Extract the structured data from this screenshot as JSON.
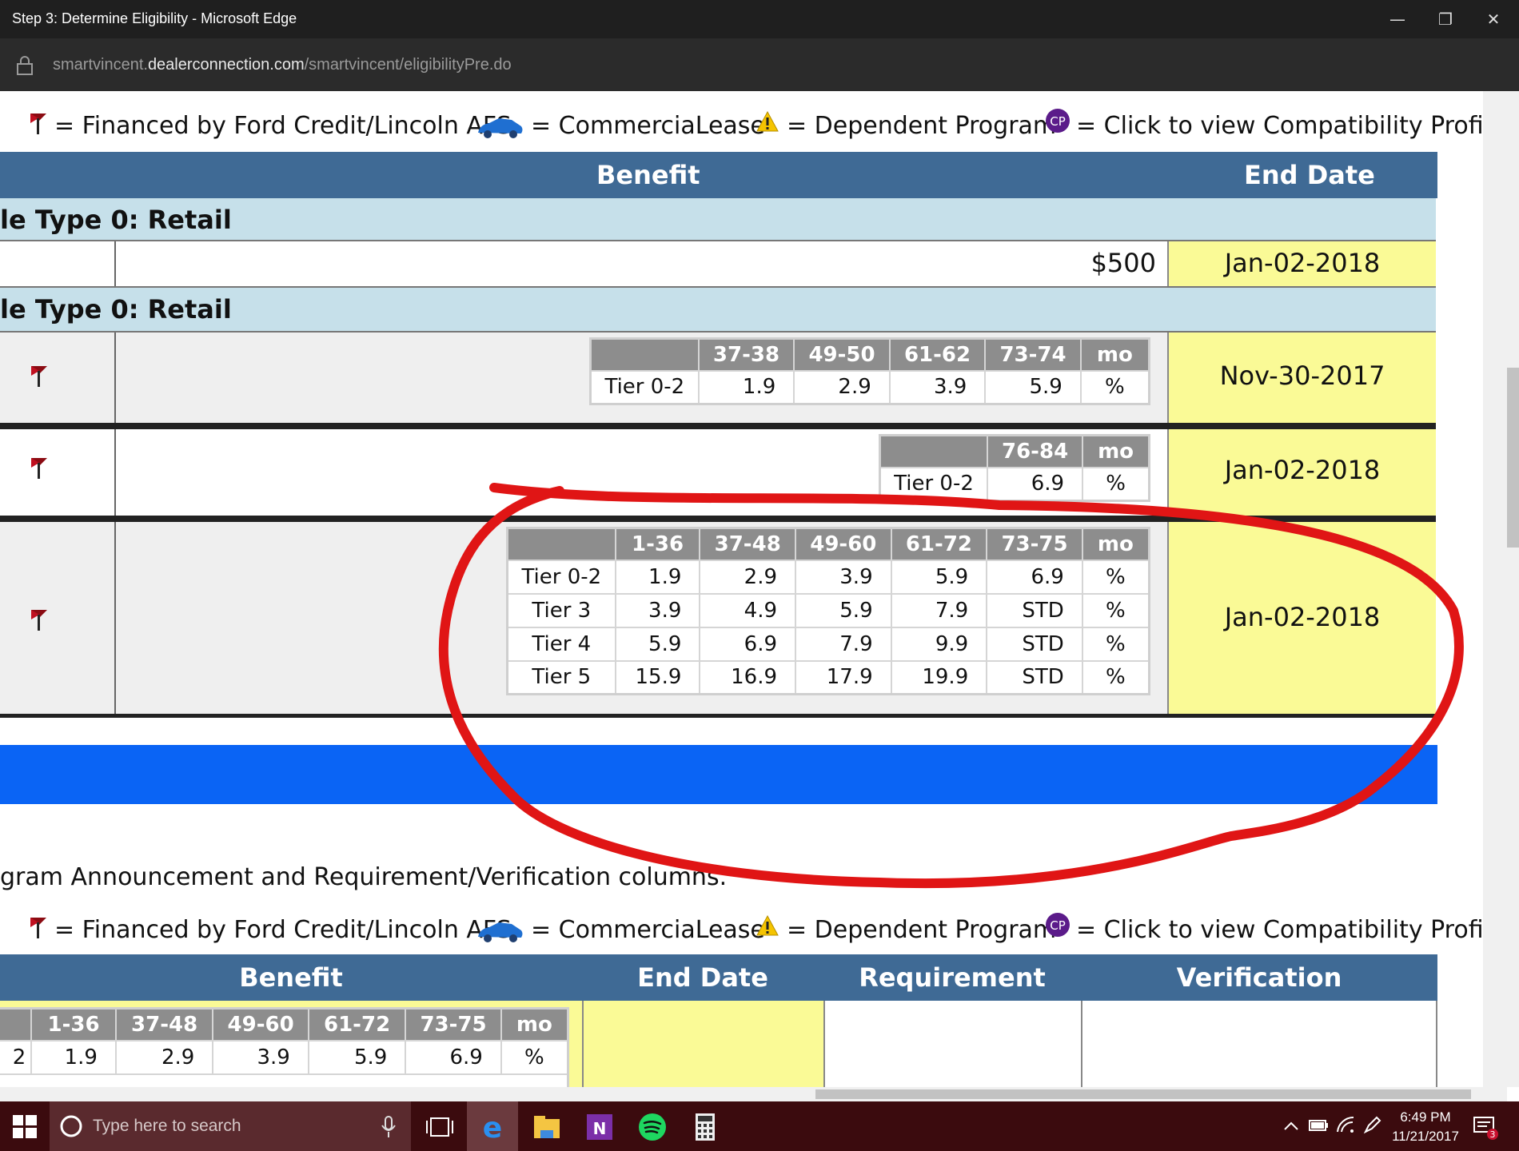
{
  "window": {
    "title": "Step 3: Determine Eligibility - Microsoft Edge",
    "controls": {
      "minimize": "—",
      "restore": "❐",
      "close": "✕"
    }
  },
  "address": {
    "url_prefix": "smartvincent.",
    "url_domain": "dealerconnection.com",
    "url_path": "/smartvincent/eligibilityPre.do"
  },
  "legend": {
    "ford_credit": "= Financed by Ford Credit/Lincoln AFS",
    "commercial_lease": "= CommerciaLease",
    "dependent": "= Dependent Program",
    "compat": "= Click to view Compatibility Profile",
    "cp_badge": "CP"
  },
  "top_table": {
    "header": {
      "benefit": "Benefit",
      "end_date": "End Date"
    },
    "section1": "le Type 0: Retail",
    "row1": {
      "benefit": "$500",
      "end_date": "Jan-02-2018"
    },
    "section2": "le Type 0: Retail",
    "row2": {
      "headers": [
        "",
        "37-38",
        "49-50",
        "61-62",
        "73-74",
        "mo"
      ],
      "rows": [
        [
          "Tier 0-2",
          "1.9",
          "2.9",
          "3.9",
          "5.9",
          "%"
        ]
      ],
      "end_date": "Nov-30-2017"
    },
    "row3": {
      "headers": [
        "",
        "76-84",
        "mo"
      ],
      "rows": [
        [
          "Tier 0-2",
          "6.9",
          "%"
        ]
      ],
      "end_date": "Jan-02-2018"
    },
    "row4": {
      "headers": [
        "",
        "1-36",
        "37-48",
        "49-60",
        "61-72",
        "73-75",
        "mo"
      ],
      "rows": [
        [
          "Tier 0-2",
          "1.9",
          "2.9",
          "3.9",
          "5.9",
          "6.9",
          "%"
        ],
        [
          "Tier 3",
          "3.9",
          "4.9",
          "5.9",
          "7.9",
          "STD",
          "%"
        ],
        [
          "Tier 4",
          "5.9",
          "6.9",
          "7.9",
          "9.9",
          "STD",
          "%"
        ],
        [
          "Tier 5",
          "15.9",
          "16.9",
          "17.9",
          "19.9",
          "STD",
          "%"
        ]
      ],
      "end_date": "Jan-02-2018"
    }
  },
  "announcement": "gram Announcement and Requirement/Verification columns.",
  "bottom_table": {
    "headers": {
      "benefit": "Benefit",
      "end_date": "End Date",
      "requirement": "Requirement",
      "verification": "Verification"
    },
    "rate_headers": [
      "",
      "1-36",
      "37-48",
      "49-60",
      "61-72",
      "73-75",
      "mo"
    ],
    "rate_row": [
      "2",
      "1.9",
      "2.9",
      "3.9",
      "5.9",
      "6.9",
      "%"
    ]
  },
  "taskbar": {
    "search_placeholder": "Type here to search",
    "time": "6:49 PM",
    "date": "11/21/2017",
    "notification_count": "3"
  },
  "colors": {
    "header_blue": "#3f6a95",
    "section_light": "#c6e0ea",
    "end_date_yellow": "#fafa96",
    "annotation_red": "#e01515",
    "band_blue": "#0a64f5"
  }
}
